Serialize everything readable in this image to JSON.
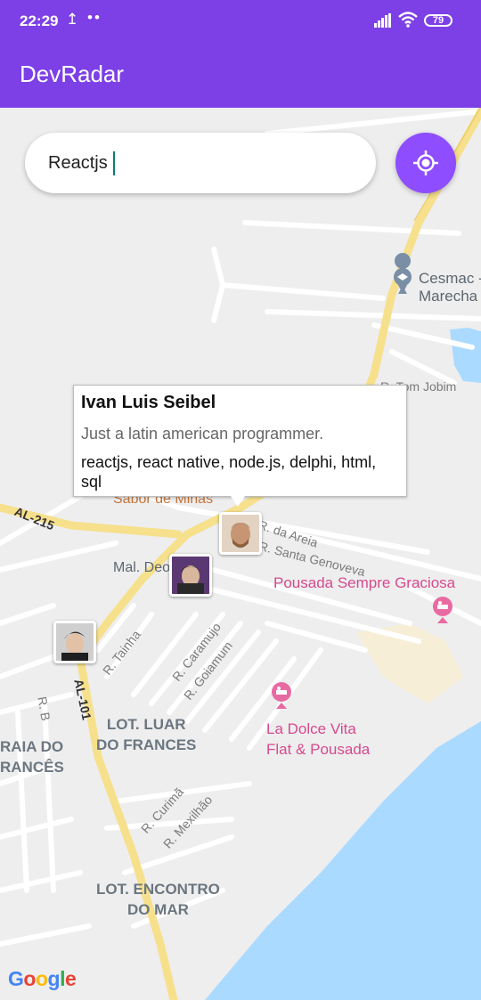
{
  "status_bar": {
    "time": "22:29",
    "battery": "79"
  },
  "app": {
    "title": "DevRadar"
  },
  "search": {
    "value": "Reactjs",
    "placeholder": ""
  },
  "map": {
    "labels": {
      "cesmac": "Cesmac -",
      "marecha": "Marecha",
      "tom_jobim": "R. Tom Jobim",
      "sabor": "Sabor de Minas",
      "da_areia": "R. da Areia",
      "santa_genoveva": "R. Santa Genoveva",
      "pousada_sempre": "Pousada Sempre Graciosa",
      "mal_deodoro": "Mal. Deo",
      "al215": "AL-215",
      "al101": "AL-101",
      "tainha": "R. Tainha",
      "caramujo": "R. Caramujo",
      "goiamum": "R. Goiamum",
      "rb": "R. B",
      "lot_luar": "LOT. LUAR\nDO FRANCES",
      "praia_frances": "RAIA DO\nRANCÊS",
      "dolce_vita": "La Dolce Vita\nFlat & Pousada",
      "curima": "R. Curimã",
      "mexilhao": "R. Mexilhão",
      "lot_encontro": "LOT. ENCONTRO\nDO MAR"
    }
  },
  "callout": {
    "name": "Ivan Luis Seibel",
    "bio": "Just a latin american programmer.",
    "techs": "reactjs, react native, node.js, delphi, html, sql"
  },
  "colors": {
    "primary": "#7d40e7",
    "button": "#8e4dff",
    "water": "#aadaff"
  },
  "icons": [
    "upload-icon",
    "signal-icon",
    "wifi-icon",
    "battery-icon",
    "my-location-icon",
    "school-pin-icon",
    "hotel-pin-icon"
  ]
}
